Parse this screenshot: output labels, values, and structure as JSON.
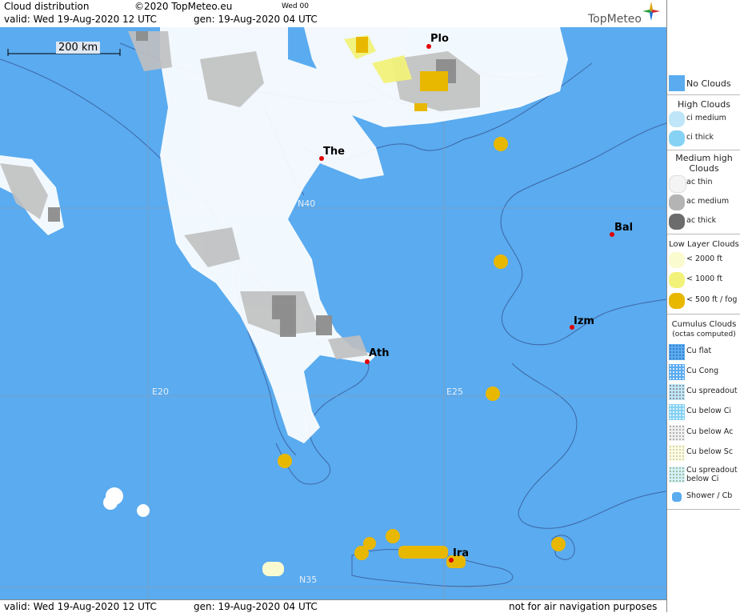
{
  "header": {
    "title": "Cloud distribution",
    "copyright": "©2020 TopMeteo.eu",
    "run_tag": "Wed 00",
    "valid_line": "valid:  Wed  19-Aug-2020  12 UTC",
    "gen_line": "gen: 19-Aug-2020 04 UTC",
    "brand": "TopMeteo"
  },
  "map": {
    "scale_label": "200 km",
    "grid_labels": {
      "n40": "N40",
      "n35": "N35",
      "e20": "E20",
      "e25": "E25"
    },
    "cities": [
      {
        "name": "Plo"
      },
      {
        "name": "The"
      },
      {
        "name": "Bal"
      },
      {
        "name": "Izm"
      },
      {
        "name": "Ath"
      },
      {
        "name": "Ira"
      }
    ]
  },
  "footer": {
    "valid_line": "valid:  Wed  19-Aug-2020  12 UTC",
    "gen_line": "gen: 19-Aug-2020 04 UTC",
    "disclaimer": "not for air navigation purposes"
  },
  "legend": {
    "no_clouds": "No Clouds",
    "high_clouds": "High Clouds",
    "ci_medium": "ci medium",
    "ci_thick": "ci thick",
    "medium_high": "Medium high Clouds",
    "ac_thin": "ac thin",
    "ac_medium": "ac medium",
    "ac_thick": "ac thick",
    "low_layer": "Low Layer Clouds",
    "lt2000": "< 2000 ft",
    "lt1000": "< 1000 ft",
    "lt500": "< 500 ft / fog",
    "cumulus": "Cumulus Clouds",
    "cumulus_sub": "(octas computed)",
    "cu_flat": "Cu flat",
    "cu_cong": "Cu Cong",
    "cu_spreadout": "Cu spreadout",
    "cu_below_ci": "Cu below Ci",
    "cu_below_ac": "Cu below Ac",
    "cu_below_sc": "Cu below Sc",
    "cu_spreadout_below_ci": "Cu spreadout below Ci",
    "shower_cb": "Shower / Cb"
  },
  "colors": {
    "sea": "#5aabef",
    "cloud_white": "#ffffff",
    "cloud_light_grey": "#c8c8c8",
    "cloud_grey": "#9a9a9a",
    "cloud_dark": "#666666",
    "low_yellow": "#f0f060",
    "fog_gold": "#e8b800",
    "city_dot": "#e00000"
  }
}
